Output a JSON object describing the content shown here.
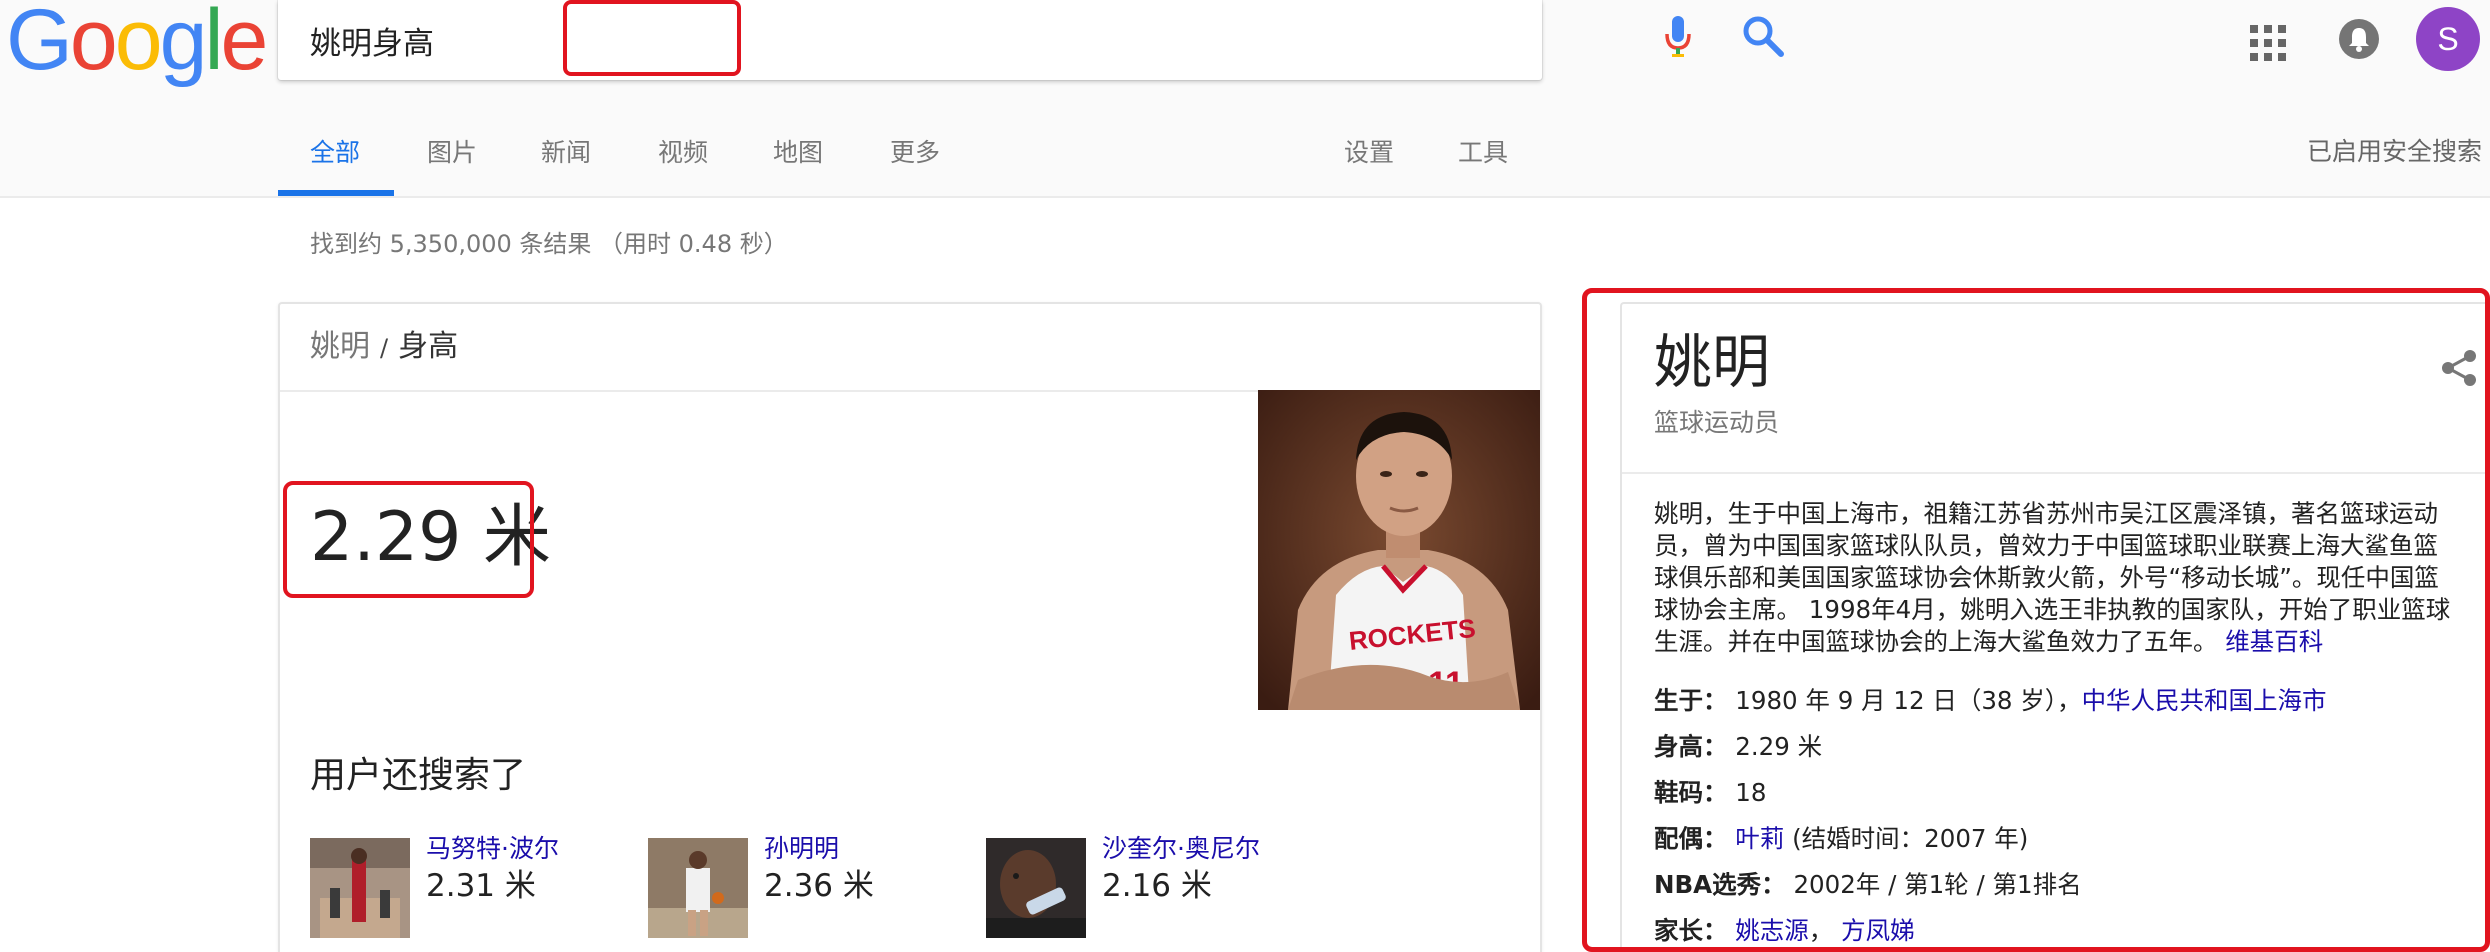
{
  "header": {
    "logo": {
      "letters": [
        "G",
        "o",
        "o",
        "g",
        "l",
        "e"
      ],
      "colors": [
        "#4285F4",
        "#EA4335",
        "#FBBC05",
        "#4285F4",
        "#34A853",
        "#EA4335"
      ]
    },
    "search": {
      "value": "姚明身高",
      "mic_icon": "mic-icon",
      "search_icon": "search-icon"
    },
    "apps_icon": "apps-grid-icon",
    "notifications_icon": "bell-icon",
    "avatar_letter": "S"
  },
  "tabs": [
    {
      "label": "全部",
      "active": true
    },
    {
      "label": "图片"
    },
    {
      "label": "新闻"
    },
    {
      "label": "视频"
    },
    {
      "label": "地图"
    },
    {
      "label": "更多"
    },
    {
      "label": "设置"
    },
    {
      "label": "工具"
    }
  ],
  "safe_search": "已启用安全搜索",
  "result_stats": "找到约 5,350,000 条结果 （用时 0.48 秒）",
  "answer": {
    "breadcrumb": {
      "entity": "姚明",
      "separator": "/",
      "attribute": "身高"
    },
    "value": "2.29 米",
    "related_title": "用户还搜索了",
    "related": [
      {
        "name": "马努特·波尔",
        "value": "2.31 米"
      },
      {
        "name": "孙明明",
        "value": "2.36 米"
      },
      {
        "name": "沙奎尔·奥尼尔",
        "value": "2.16 米"
      }
    ]
  },
  "knowledge_panel": {
    "title": "姚明",
    "subtitle": "篮球运动员",
    "share_icon": "share-icon",
    "description_lines": [
      "姚明，生于中国上海市，祖籍江苏省苏州市吴江区震泽镇，著名篮球运动",
      "员，曾为中国国家篮球队队员，曾效力于中国篮球职业联赛上海大鲨鱼篮",
      "球俱乐部和美国国家篮球协会休斯敦火箭，外号“移动长城”。现任中国篮",
      "球协会主席。 1998年4月，姚明入选王非执教的国家队，开始了职业篮球"
    ],
    "description_last": "生涯。并在中国篮球协会的上海大鲨鱼效力了五年。 ",
    "description_source": "维基百科",
    "facts": {
      "born_label": "生于：",
      "born_value": "1980 年 9 月 12 日（38 岁），",
      "born_link": "中华人民共和国上海市",
      "height_label": "身高：",
      "height_value": "2.29 米",
      "shoe_label": "鞋码：",
      "shoe_value": "18",
      "spouse_label": "配偶：",
      "spouse_link": "叶莉",
      "spouse_note": " (结婚时间：2007 年)",
      "draft_label": "NBA选秀：",
      "draft_value": "2002年 / 第1轮 / 第1排名",
      "parents_label": "家长：",
      "parent_1": "姚志源",
      "parent_sep": "， ",
      "parent_2": "方凤娣"
    }
  }
}
